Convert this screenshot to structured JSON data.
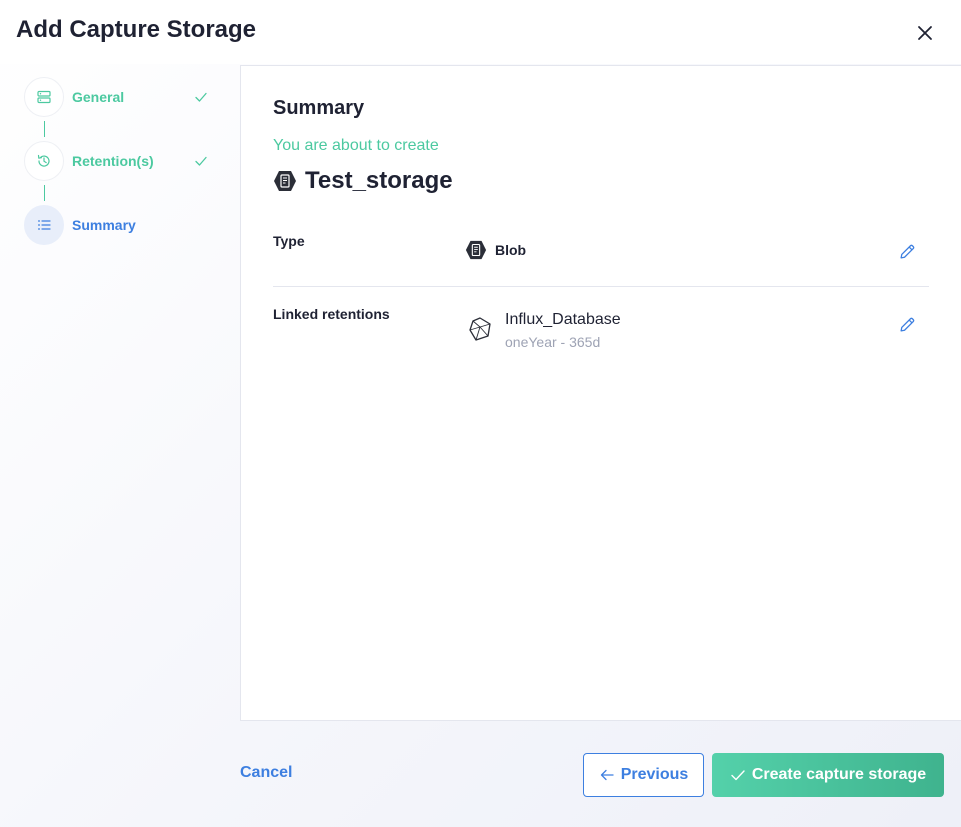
{
  "dialog": {
    "title": "Add Capture Storage",
    "close_icon": "close-icon"
  },
  "stepper": {
    "steps": [
      {
        "label": "General",
        "icon": "server-icon",
        "status": "completed"
      },
      {
        "label": "Retention(s)",
        "icon": "history-icon",
        "status": "completed"
      },
      {
        "label": "Summary",
        "icon": "list-icon",
        "status": "active"
      }
    ]
  },
  "summary": {
    "title": "Summary",
    "about_text": "You are about to create",
    "storage_name": "Test_storage",
    "storage_icon": "blob-storage-icon",
    "type": {
      "label": "Type",
      "value": "Blob",
      "icon": "blob-storage-icon"
    },
    "linked_retentions": {
      "label": "Linked retentions",
      "items": [
        {
          "name": "Influx_Database",
          "detail": "oneYear - 365d",
          "icon": "database-polyhedron-icon"
        }
      ]
    }
  },
  "footer": {
    "cancel_label": "Cancel",
    "previous_label": "Previous",
    "create_label": "Create capture storage"
  },
  "colors": {
    "accent_green": "#4cc9a0",
    "accent_blue": "#3d7fe0",
    "text_dark": "#1f2233",
    "text_muted": "#9ea3b4"
  }
}
